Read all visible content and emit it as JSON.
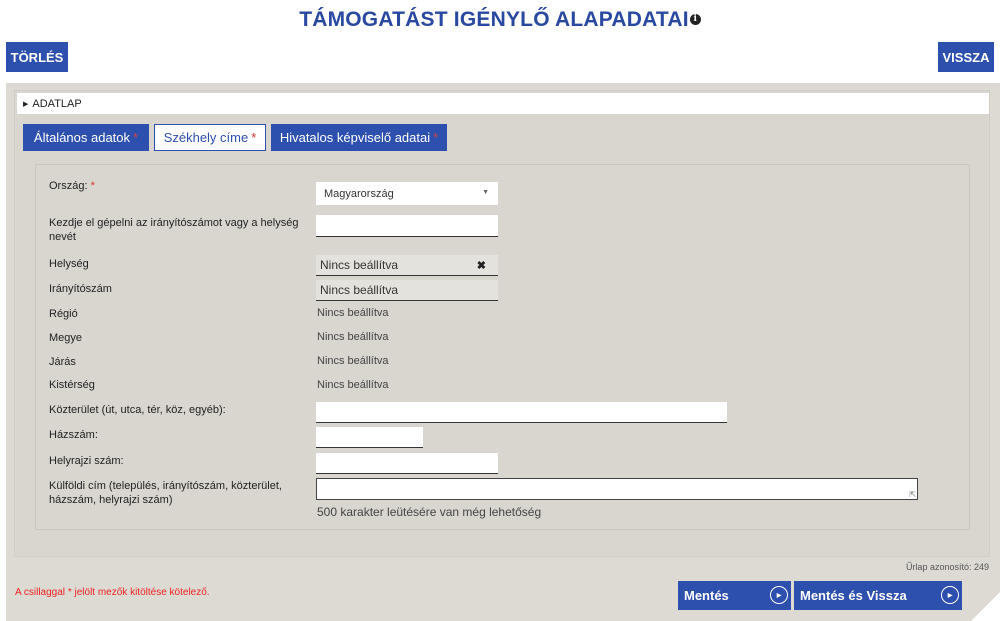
{
  "header": {
    "title": "TÁMOGATÁST IGÉNYLŐ ALAPADATAI",
    "info_icon": "info-icon"
  },
  "toolbar": {
    "delete_label": "TÖRLÉS",
    "back_label": "VISSZA"
  },
  "section": {
    "label": "ADATLAP"
  },
  "tabs": [
    {
      "label": "Általános adatok",
      "required": "*",
      "active": false
    },
    {
      "label": "Székhely címe",
      "required": "*",
      "active": true
    },
    {
      "label": "Hivatalos képviselő adatai",
      "required": "*",
      "active": false
    }
  ],
  "form": {
    "country": {
      "label": "Ország:",
      "required": "*",
      "value": "Magyarország"
    },
    "zip_search": {
      "label": "Kezdje el gépelni az irányítószámot vagy a helység nevét",
      "value": ""
    },
    "locality": {
      "label": "Helység",
      "value": "Nincs beállítva"
    },
    "zip": {
      "label": "Irányítószám",
      "value": "Nincs beállítva"
    },
    "region": {
      "label": "Régió",
      "value": "Nincs beállítva"
    },
    "county": {
      "label": "Megye",
      "value": "Nincs beállítva"
    },
    "district": {
      "label": "Járás",
      "value": "Nincs beállítva"
    },
    "subregion": {
      "label": "Kistérség",
      "value": "Nincs beállítva"
    },
    "street": {
      "label": "Közterület (út, utca, tér, köz, egyéb):",
      "value": ""
    },
    "house_number": {
      "label": "Házszám:",
      "value": ""
    },
    "parcel_number": {
      "label": "Helyrajzi szám:",
      "value": ""
    },
    "foreign_address": {
      "label": "Külföldi cím (település, irányítószám, közterület, házszám, helyrajzi szám)",
      "value": ""
    },
    "char_hint": "500 karakter leütésére van még lehetőség"
  },
  "footer": {
    "required_note_pre": "A csillaggal ",
    "required_note_star": "*",
    "required_note_post": " jelölt mezők kitöltése kötelező.",
    "form_id": "Űrlap azonosító: 249",
    "save_label": "Mentés",
    "save_back_label": "Mentés és Vissza"
  },
  "colors": {
    "accent": "#2d4fae",
    "title": "#2948a0",
    "required": "#dd3333",
    "background": "#dcdad3"
  }
}
